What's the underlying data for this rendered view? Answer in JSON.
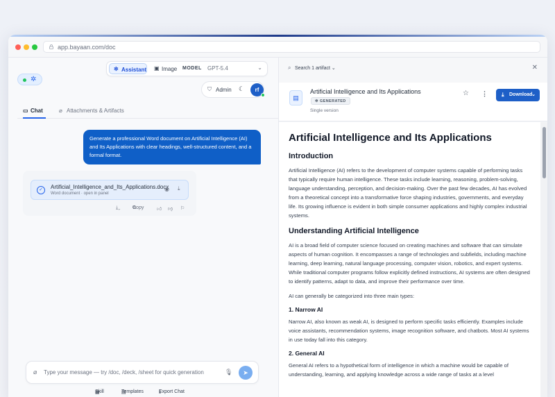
{
  "browser": {
    "url": "app.bayaan.com/doc"
  },
  "left": {
    "mode_bar": {
      "assistant_label": "Assistant",
      "image_label": "Image",
      "model_label": "MODEL",
      "model_value": "GPT-5.4"
    },
    "admin_label": "Admin",
    "avatar_initials": "rf",
    "tabs": [
      {
        "label": "Chat"
      },
      {
        "label": "Attachments & Artifacts"
      }
    ],
    "user_message": "Generate a professional Word document on Artificial Intelligence (AI) and Its Applications with clear headings, well-structured content, and a formal format.",
    "file_card": {
      "name": "Artificial_Intelligence_and_Its_Applications.docx",
      "subtitle": "Word document · open in panel"
    },
    "message_actions": {
      "copy_label": "Copy"
    },
    "composer": {
      "placeholder": "Type your message — try /doc, /deck, /sheet for quick generation"
    },
    "bottom_links": [
      {
        "label": "Skill"
      },
      {
        "label": "Templates"
      },
      {
        "label": "Export Chat"
      }
    ]
  },
  "right": {
    "search_label": "Search 1 artifact",
    "doc_title": "Artificial Intelligence and Its Applications",
    "badge": "GENERATED",
    "version": "Single version",
    "download_label": "Download",
    "document": {
      "h1": "Artificial Intelligence and Its Applications",
      "intro_h2": "Introduction",
      "intro_p": "Artificial Intelligence (AI) refers to the development of computer systems capable of performing tasks that typically require human intelligence. These tasks include learning, reasoning, problem-solving, language understanding, perception, and decision-making. Over the past few decades, AI has evolved from a theoretical concept into a transformative force shaping industries, governments, and everyday life. Its growing influence is evident in both simple consumer applications and highly complex industrial systems.",
      "understanding_h2": "Understanding Artificial Intelligence",
      "understanding_p1": "AI is a broad field of computer science focused on creating machines and software that can simulate aspects of human cognition. It encompasses a range of technologies and subfields, including machine learning, deep learning, natural language processing, computer vision, robotics, and expert systems. While traditional computer programs follow explicitly defined instructions, AI systems are often designed to identify patterns, adapt to data, and improve their performance over time.",
      "understanding_p2": "AI can generally be categorized into three main types:",
      "narrow_h3": "1. Narrow AI",
      "narrow_p": "Narrow AI, also known as weak AI, is designed to perform specific tasks efficiently. Examples include voice assistants, recommendation systems, image recognition software, and chatbots. Most AI systems in use today fall into this category.",
      "general_h3": "2. General AI",
      "general_p": "General AI refers to a hypothetical form of intelligence in which a machine would be capable of understanding, learning, and applying knowledge across a wide range of tasks at a level"
    }
  }
}
